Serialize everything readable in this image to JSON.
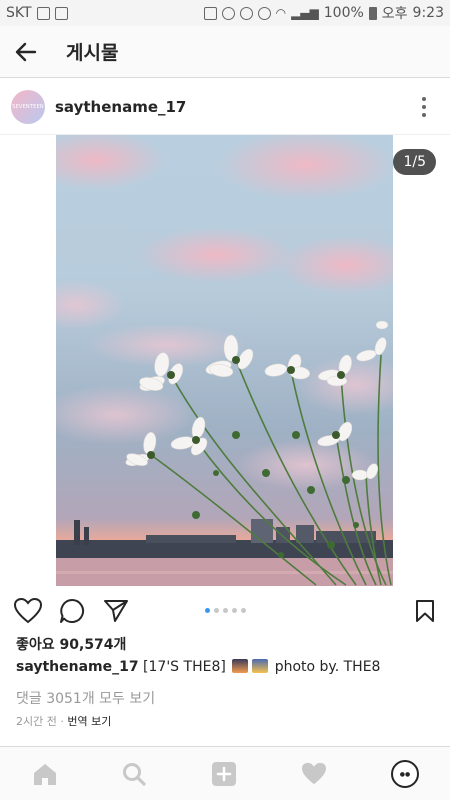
{
  "status_bar": {
    "carrier": "SKT",
    "battery": "100%",
    "ampm": "오후",
    "time": "9:23"
  },
  "header": {
    "title": "게시물",
    "back_icon": "arrow-left-icon"
  },
  "post": {
    "username": "saythename_17",
    "avatar_label": "SEVENTEEN",
    "image_counter": "1/5",
    "carousel": {
      "count": 5,
      "active_index": 0
    },
    "likes_label": "좋아요 90,574개",
    "caption_user": "saythename_17",
    "caption_text_1": " [17'S THE8] ",
    "caption_text_2": " photo by. THE8",
    "comments_label": "댓글 3051개 모두 보기",
    "time_label": "2시간 전",
    "time_separator": " · ",
    "translate_label": "번역 보기"
  },
  "colors": {
    "accent": "#3897f0",
    "text": "#262626",
    "muted": "#999999"
  }
}
